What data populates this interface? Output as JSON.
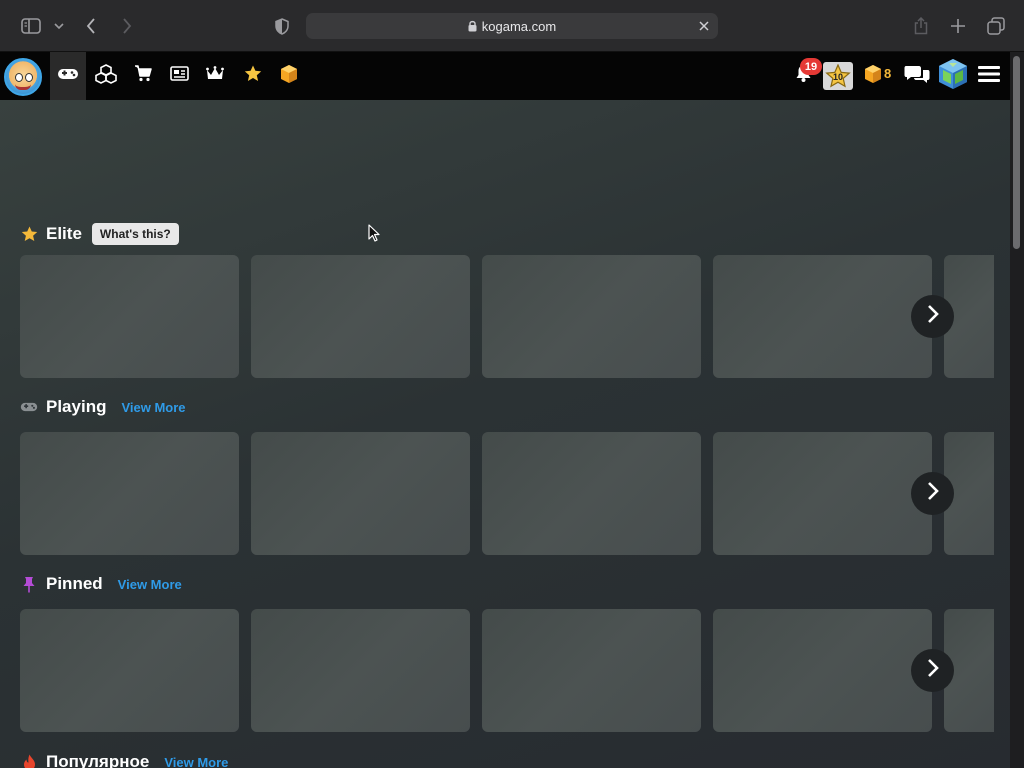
{
  "browser": {
    "url": "kogama.com"
  },
  "nav": {
    "notifications_count": "19",
    "level": "10",
    "gold_count": "8"
  },
  "sections": [
    {
      "title": "Elite",
      "extra_label": "What's this?",
      "card_count": 5
    },
    {
      "title": "Playing",
      "extra_label": "View More",
      "card_count": 5
    },
    {
      "title": "Pinned",
      "extra_label": "View More",
      "card_count": 5
    },
    {
      "title": "Популярное",
      "extra_label": "View More",
      "card_count": 0
    }
  ],
  "colors": {
    "accent_link": "#2f9be8",
    "star": "#f5b93a",
    "pin": "#b44cd6",
    "fire": "#e8452c",
    "badge": "#e53935"
  }
}
